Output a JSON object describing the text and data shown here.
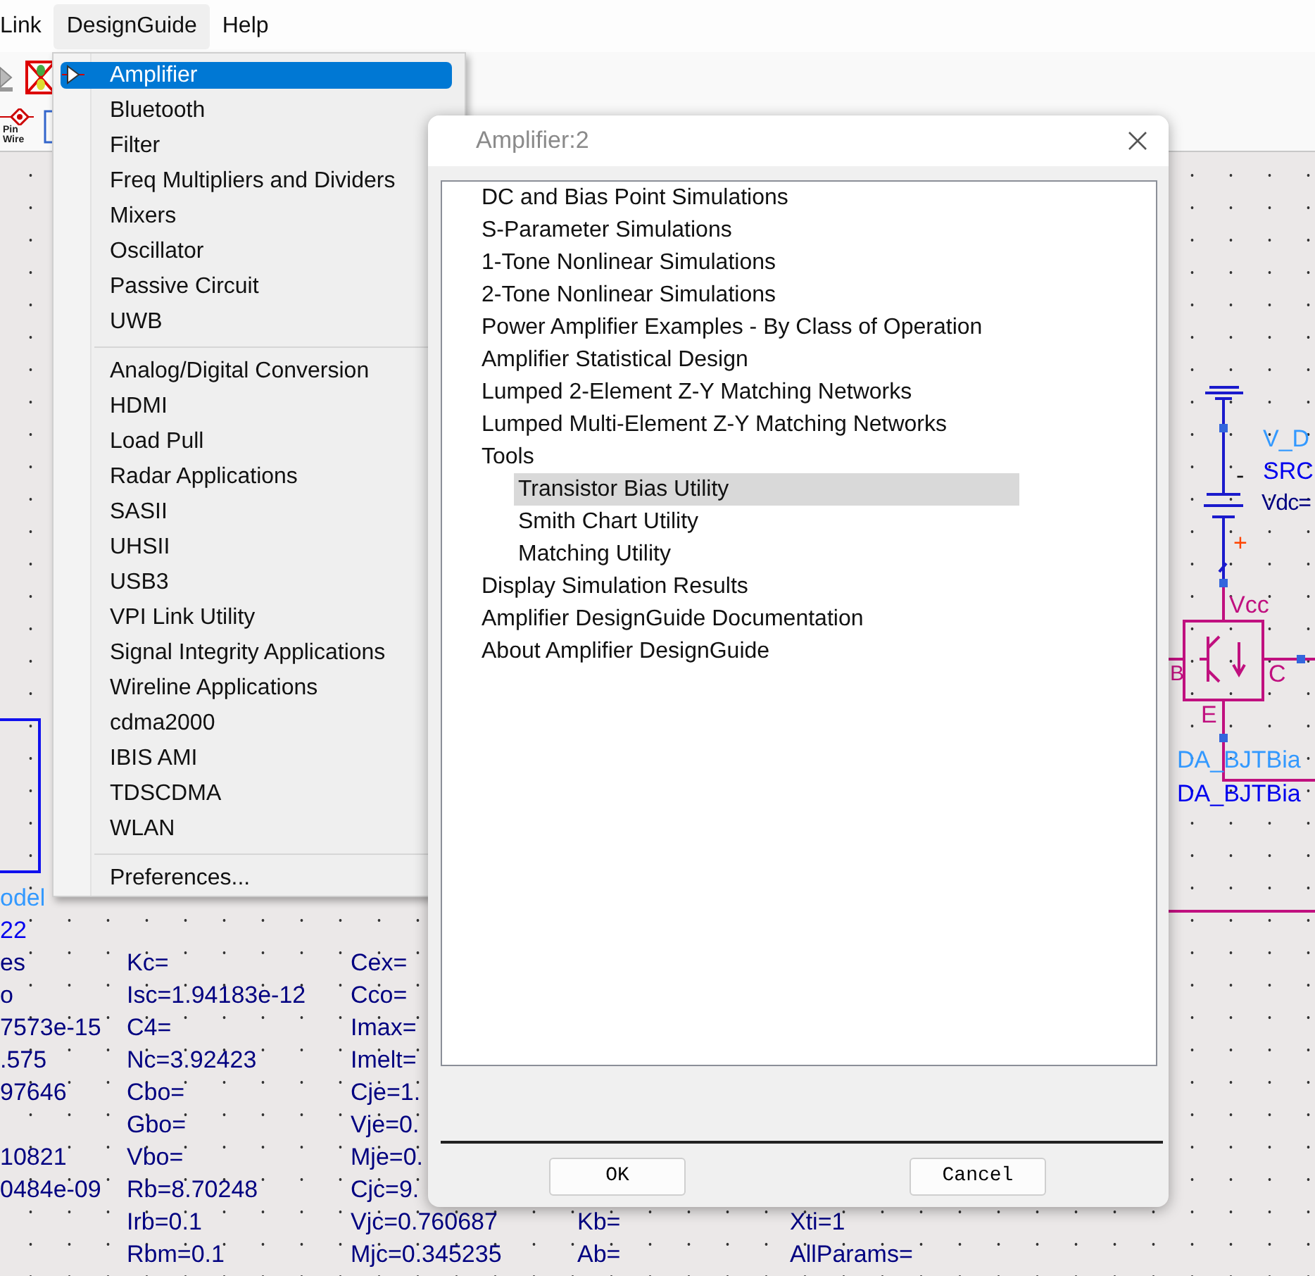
{
  "menu_bar": [
    {
      "label": "Link",
      "selected": false
    },
    {
      "label": "DesignGuide",
      "selected": true
    },
    {
      "label": "Help",
      "selected": false
    }
  ],
  "toolbar": {
    "pin_wire_caption": [
      "Pin",
      "Wire"
    ]
  },
  "dropdown": {
    "groups": [
      {
        "items": [
          {
            "label": "Amplifier",
            "selected": true,
            "has_icon": true
          },
          {
            "label": "Bluetooth",
            "selected": false,
            "has_icon": false
          },
          {
            "label": "Filter",
            "selected": false,
            "has_icon": false
          },
          {
            "label": "Freq Multipliers and Dividers",
            "selected": false,
            "has_icon": false
          },
          {
            "label": "Mixers",
            "selected": false,
            "has_icon": false
          },
          {
            "label": "Oscillator",
            "selected": false,
            "has_icon": false
          },
          {
            "label": "Passive Circuit",
            "selected": false,
            "has_icon": false
          },
          {
            "label": "UWB",
            "selected": false,
            "has_icon": false
          }
        ]
      },
      {
        "items": [
          {
            "label": "Analog/Digital Conversion",
            "selected": false,
            "has_icon": false
          },
          {
            "label": "HDMI",
            "selected": false,
            "has_icon": false
          },
          {
            "label": "Load Pull",
            "selected": false,
            "has_icon": false
          },
          {
            "label": "Radar Applications",
            "selected": false,
            "has_icon": false
          },
          {
            "label": "SASII",
            "selected": false,
            "has_icon": false
          },
          {
            "label": "UHSII",
            "selected": false,
            "has_icon": false
          },
          {
            "label": "USB3",
            "selected": false,
            "has_icon": false
          },
          {
            "label": "VPI Link Utility",
            "selected": false,
            "has_icon": false
          },
          {
            "label": "Signal Integrity Applications",
            "selected": false,
            "has_icon": false
          },
          {
            "label": "Wireline Applications",
            "selected": false,
            "has_icon": false
          },
          {
            "label": "cdma2000",
            "selected": false,
            "has_icon": false
          },
          {
            "label": "IBIS AMI",
            "selected": false,
            "has_icon": false
          },
          {
            "label": "TDSCDMA",
            "selected": false,
            "has_icon": false
          },
          {
            "label": "WLAN",
            "selected": false,
            "has_icon": false
          }
        ]
      },
      {
        "items": [
          {
            "label": "Preferences...",
            "selected": false,
            "has_icon": false
          }
        ]
      }
    ]
  },
  "dialog": {
    "title": "Amplifier:2",
    "items": [
      {
        "label": "DC and Bias Point Simulations",
        "selected": false
      },
      {
        "label": "S-Parameter Simulations",
        "selected": false
      },
      {
        "label": "1-Tone Nonlinear Simulations",
        "selected": false
      },
      {
        "label": "2-Tone Nonlinear Simulations",
        "selected": false
      },
      {
        "label": "Power Amplifier Examples - By Class of Operation",
        "selected": false
      },
      {
        "label": "Amplifier Statistical Design",
        "selected": false
      },
      {
        "label": "Lumped 2-Element Z-Y Matching Networks",
        "selected": false
      },
      {
        "label": "Lumped Multi-Element Z-Y Matching Networks",
        "selected": false
      },
      {
        "label": "Tools",
        "selected": false,
        "children": [
          {
            "label": "Transistor Bias Utility",
            "selected": true
          },
          {
            "label": "Smith Chart Utility",
            "selected": false
          },
          {
            "label": "Matching Utility",
            "selected": false
          }
        ]
      },
      {
        "label": "Display Simulation Results",
        "selected": false
      },
      {
        "label": "Amplifier DesignGuide Documentation",
        "selected": false
      },
      {
        "label": "About Amplifier DesignGuide",
        "selected": false
      }
    ],
    "buttons": [
      "OK",
      "Cancel"
    ]
  },
  "schematic": {
    "instance_lines": [
      {
        "text": "odel",
        "kind": "name"
      },
      {
        "text": "22",
        "kind": "id"
      }
    ],
    "parameter_rows": [
      [
        "es",
        "Kc=",
        "Cex=",
        null,
        null
      ],
      [
        "o",
        "Isc=1.94183e-12",
        "Cco=",
        null,
        null
      ],
      [
        "7573e-15",
        "C4=",
        "Imax=",
        null,
        null
      ],
      [
        ".575",
        "Nc=3.92423",
        "Imelt=",
        null,
        null
      ],
      [
        "97646",
        "Cbo=",
        "Cje=1.",
        null,
        null
      ],
      [
        null,
        "Gbo=",
        "Vje=0.",
        null,
        null
      ],
      [
        "10821",
        "Vbo=",
        "Mje=0.",
        null,
        null
      ],
      [
        "0484e-09",
        "Rb=8.70248",
        "Cjc=9.",
        null,
        null
      ],
      [
        null,
        "Irb=0.1",
        "Vjc=0.760687",
        "Kb=",
        "Xti=1"
      ],
      [
        null,
        "Rbm=0.1",
        "Mjc=0.345235",
        "Ab=",
        "AllParams="
      ]
    ],
    "dc_source": {
      "name": "V_D",
      "id": "SRC",
      "param": "Vdc=",
      "minus": "-",
      "plus": "+"
    },
    "bias_block": {
      "pin_top": "Vcc",
      "pin_left": "B",
      "pin_right": "C",
      "pin_bottom": "E",
      "name": "DA_BJTBia",
      "id": "DA_BJTBia"
    }
  }
}
